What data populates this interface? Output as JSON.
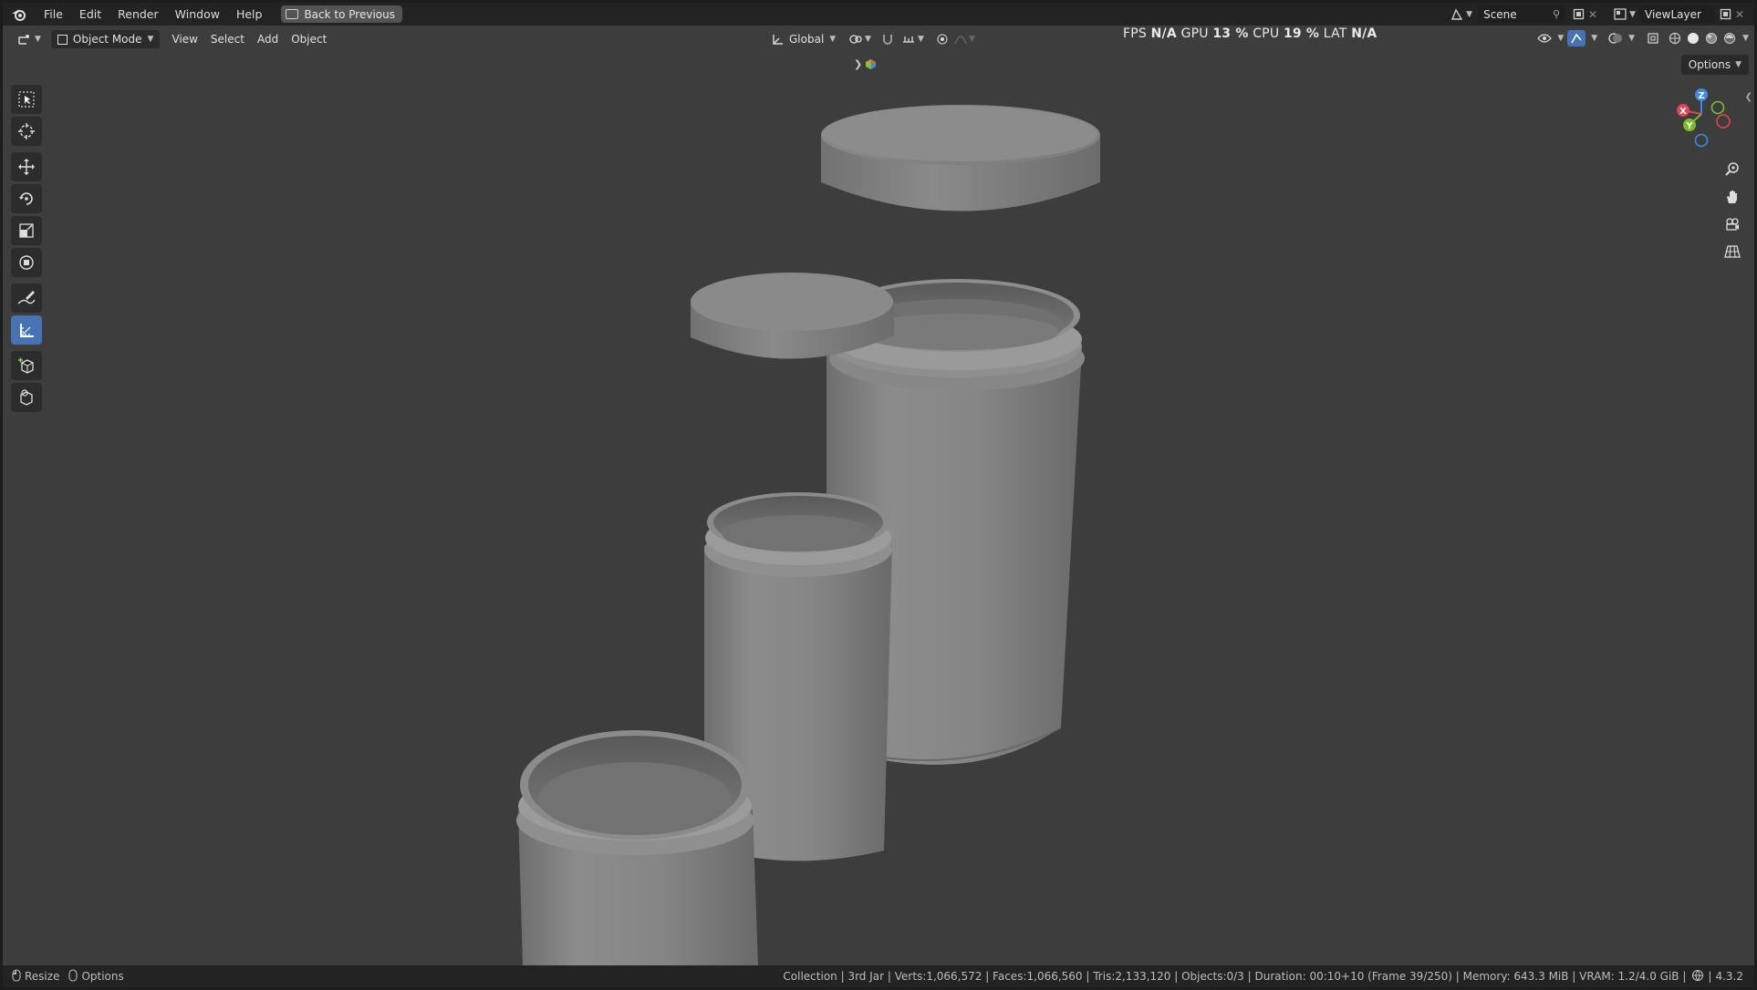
{
  "menu": {
    "items": [
      "File",
      "Edit",
      "Render",
      "Window",
      "Help"
    ],
    "back_button": "Back to Previous"
  },
  "workspace": {
    "scene_label": "Scene",
    "view_layer_label": "ViewLayer"
  },
  "header": {
    "mode": "Object Mode",
    "menus": [
      "View",
      "Select",
      "Add",
      "Object"
    ],
    "orientation": "Global",
    "options_label": "Options"
  },
  "stats": {
    "fps_label": "FPS",
    "fps_value": "N/A",
    "gpu_label": "GPU",
    "gpu_value": "13 %",
    "cpu_label": "CPU",
    "cpu_value": "19 %",
    "lat_label": "LAT",
    "lat_value": "N/A"
  },
  "gizmo": {
    "axis_x": "X",
    "axis_y": "Y",
    "axis_z": "Z",
    "x_color": "#e04455",
    "y_color": "#7bbd28",
    "z_color": "#3d8ae0"
  },
  "status": {
    "left_items": [
      "Resize",
      "Options"
    ],
    "info": "Collection | 3rd Jar | Verts:1,066,572 | Faces:1,066,560 | Tris:2,133,120 | Objects:0/3 | Duration: 00:10+10 (Frame 39/250) | Memory: 643.3 MiB | VRAM: 1.2/4.0 GiB |",
    "version": "4.3.2"
  },
  "colors": {
    "viewport_bg": "#3d3d3d",
    "accent": "#4772b3"
  }
}
